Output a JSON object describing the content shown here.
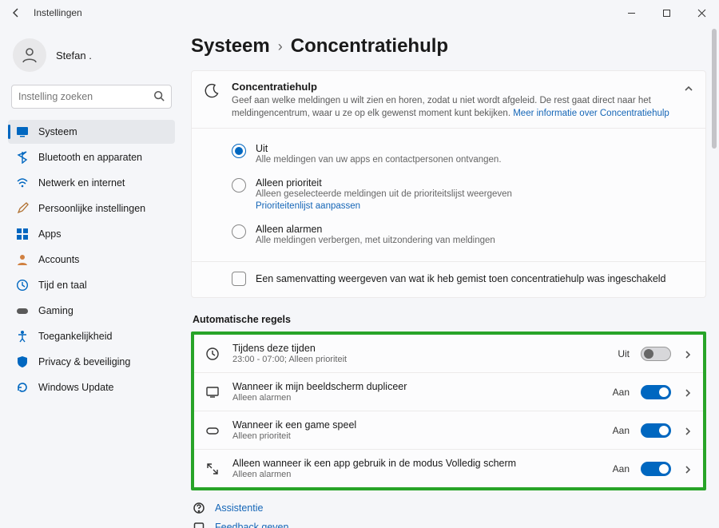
{
  "titlebar": {
    "app_title": "Instellingen"
  },
  "user": {
    "name": "Stefan ."
  },
  "search": {
    "placeholder": "Instelling zoeken"
  },
  "sidebar": {
    "items": [
      {
        "label": "Systeem",
        "icon": "monitor",
        "selected": true
      },
      {
        "label": "Bluetooth en apparaten",
        "icon": "bluetooth"
      },
      {
        "label": "Netwerk en internet",
        "icon": "wifi"
      },
      {
        "label": "Persoonlijke instellingen",
        "icon": "brush"
      },
      {
        "label": "Apps",
        "icon": "apps"
      },
      {
        "label": "Accounts",
        "icon": "person"
      },
      {
        "label": "Tijd en taal",
        "icon": "clock"
      },
      {
        "label": "Gaming",
        "icon": "game"
      },
      {
        "label": "Toegankelijkheid",
        "icon": "access"
      },
      {
        "label": "Privacy & beveiliging",
        "icon": "shield"
      },
      {
        "label": "Windows Update",
        "icon": "update"
      }
    ]
  },
  "breadcrumb": {
    "parent": "Systeem",
    "current": "Concentratiehulp"
  },
  "header_card": {
    "title": "Concentratiehulp",
    "desc_prefix": "Geef aan welke meldingen u wilt zien en horen, zodat u niet wordt afgeleid. De rest gaat direct naar het meldingencentrum, waar u ze op elk gewenst moment kunt bekijken.  ",
    "desc_link": "Meer informatie over Concentratiehulp"
  },
  "radio_options": [
    {
      "title": "Uit",
      "desc": "Alle meldingen van uw apps en contactpersonen ontvangen.",
      "checked": true
    },
    {
      "title": "Alleen prioriteit",
      "desc": "Alleen geselecteerde meldingen uit de prioriteitslijst weergeven",
      "link": "Prioriteitenlijst aanpassen"
    },
    {
      "title": "Alleen alarmen",
      "desc": "Alle meldingen verbergen, met uitzondering van meldingen"
    }
  ],
  "summary_checkbox": {
    "label": "Een samenvatting weergeven van wat ik heb gemist toen concentratiehulp was ingeschakeld"
  },
  "rules_heading": "Automatische regels",
  "rules": [
    {
      "icon": "clock",
      "title": "Tijdens deze tijden",
      "desc": "23:00 - 07:00; Alleen prioriteit",
      "state": "Uit",
      "on": false
    },
    {
      "icon": "monitor",
      "title": "Wanneer ik mijn beeldscherm dupliceer",
      "desc": "Alleen alarmen",
      "state": "Aan",
      "on": true
    },
    {
      "icon": "game",
      "title": "Wanneer ik een game speel",
      "desc": "Alleen prioriteit",
      "state": "Aan",
      "on": true
    },
    {
      "icon": "expand",
      "title": "Alleen wanneer ik een app gebruik in de modus Volledig scherm",
      "desc": "Alleen alarmen",
      "state": "Aan",
      "on": true
    }
  ],
  "footer_links": [
    {
      "icon": "help",
      "label": "Assistentie"
    },
    {
      "icon": "feedback",
      "label": "Feedback geven"
    }
  ],
  "icon_colors": {
    "monitor_fill": "#0067c0",
    "bluetooth_fill": "#0067c0",
    "wifi_fill": "#0067c0",
    "brush_stroke": "#b07030",
    "apps_fill": "#0067c0",
    "person_fill": "#d08040",
    "clock_fill": "#0067c0",
    "game_fill": "#5a5a5a",
    "access_fill": "#0067c0",
    "shield_fill": "#0067c0",
    "update_fill": "#0067c0"
  }
}
